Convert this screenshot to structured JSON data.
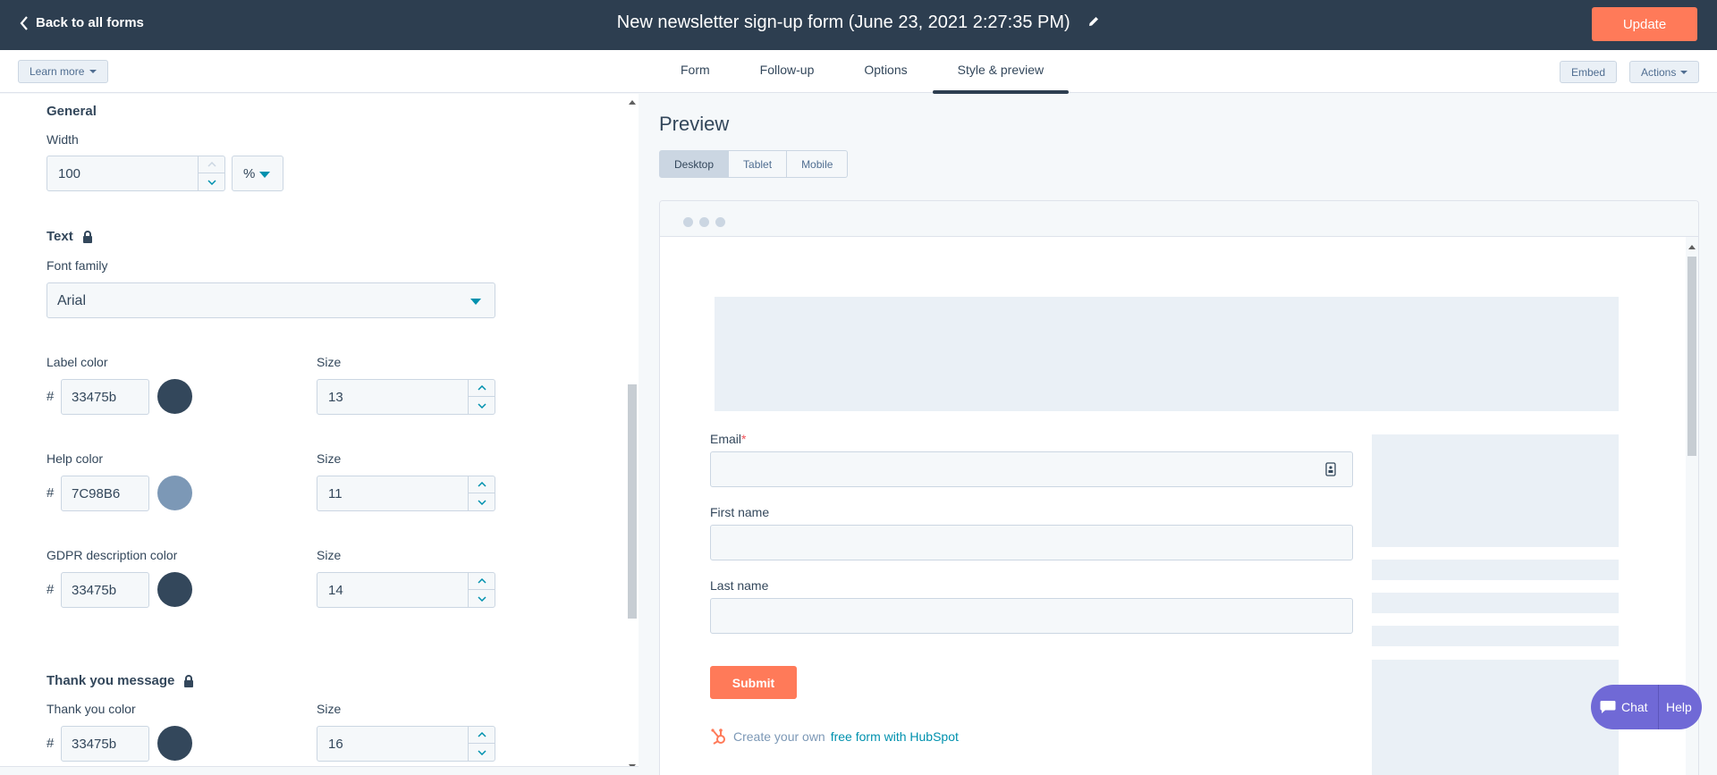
{
  "topbar": {
    "back_label": "Back to all forms",
    "title": "New newsletter sign-up form (June 23, 2021 2:27:35 PM)",
    "update_label": "Update"
  },
  "subbar": {
    "learn_more": "Learn more",
    "tabs": [
      {
        "label": "Form"
      },
      {
        "label": "Follow-up"
      },
      {
        "label": "Options"
      },
      {
        "label": "Style & preview",
        "active": true
      }
    ],
    "embed_label": "Embed",
    "actions_label": "Actions"
  },
  "style_panel": {
    "general": {
      "heading": "General",
      "width_label": "Width",
      "width_value": "100",
      "width_unit": "%"
    },
    "text": {
      "heading": "Text",
      "font_family_label": "Font family",
      "font_family_value": "Arial",
      "hash": "#",
      "size_label": "Size",
      "label_color_label": "Label color",
      "label_color_value": "33475b",
      "label_color_hex": "#33475b",
      "label_size": "13",
      "help_color_label": "Help color",
      "help_color_value": "7C98B6",
      "help_color_hex": "#7c98b6",
      "help_size": "11",
      "gdpr_color_label": "GDPR description color",
      "gdpr_color_value": "33475b",
      "gdpr_color_hex": "#33475b",
      "gdpr_size": "14"
    },
    "thank_you": {
      "heading": "Thank you message",
      "color_label": "Thank you color",
      "color_value": "33475b",
      "color_hex": "#33475b",
      "size": "16"
    }
  },
  "preview": {
    "heading": "Preview",
    "devices": [
      {
        "label": "Desktop",
        "active": true
      },
      {
        "label": "Tablet"
      },
      {
        "label": "Mobile"
      }
    ],
    "form": {
      "email_label": "Email",
      "required_mark": "*",
      "first_name_label": "First name",
      "last_name_label": "Last name",
      "submit_label": "Submit",
      "branding_text": "Create your own",
      "branding_link": "free form with HubSpot"
    }
  },
  "chat_widget": {
    "chat_label": "Chat",
    "help_label": "Help"
  },
  "colors": {
    "accent": "#ff7a59",
    "header_bg": "#2d3e50",
    "link": "#0091ae",
    "chat": "#7069d6"
  }
}
